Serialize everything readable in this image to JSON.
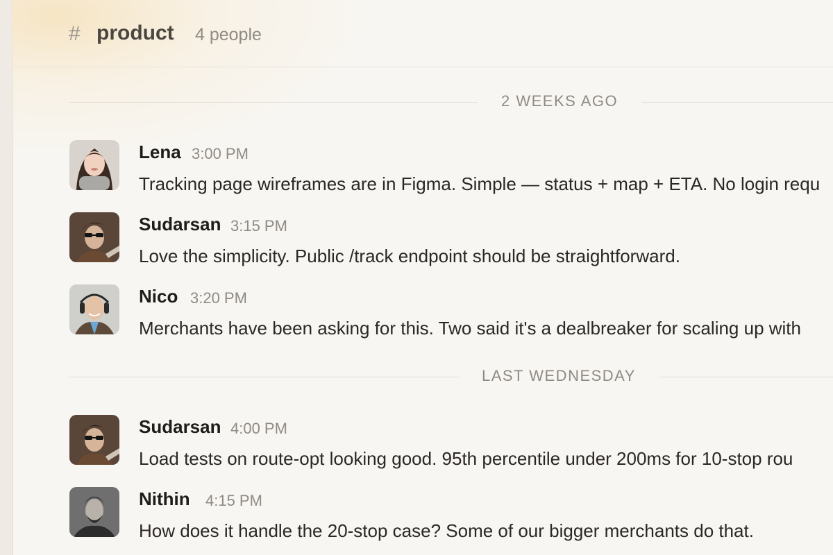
{
  "channel": {
    "hash": "#",
    "name": "product",
    "members": "4 people"
  },
  "dividers": [
    {
      "label": "2 WEEKS AGO"
    },
    {
      "label": "LAST WEDNESDAY"
    }
  ],
  "messages": [
    {
      "author": "Lena",
      "time": "3:00 PM",
      "text": "Tracking page wireframes are in Figma. Simple — status + map + ETA. No login requ"
    },
    {
      "author": "Sudarsan",
      "time": "3:15 PM",
      "text": "Love the simplicity. Public /track endpoint should be straightforward."
    },
    {
      "author": "Nico",
      "time": "3:20 PM",
      "text": "Merchants have been asking for this. Two said it's a dealbreaker for scaling up with"
    },
    {
      "author": "Sudarsan",
      "time": "4:00 PM",
      "text": "Load tests on route-opt looking good. 95th percentile under 200ms for 10-stop rou"
    },
    {
      "author": "Nithin",
      "time": "4:15 PM",
      "text": "How does it handle the 20-stop case? Some of our bigger merchants do that."
    }
  ],
  "colors": {
    "background": "#f8f6f2",
    "accent_glow": "#f6e2bc",
    "muted_text": "#8f8a83"
  }
}
